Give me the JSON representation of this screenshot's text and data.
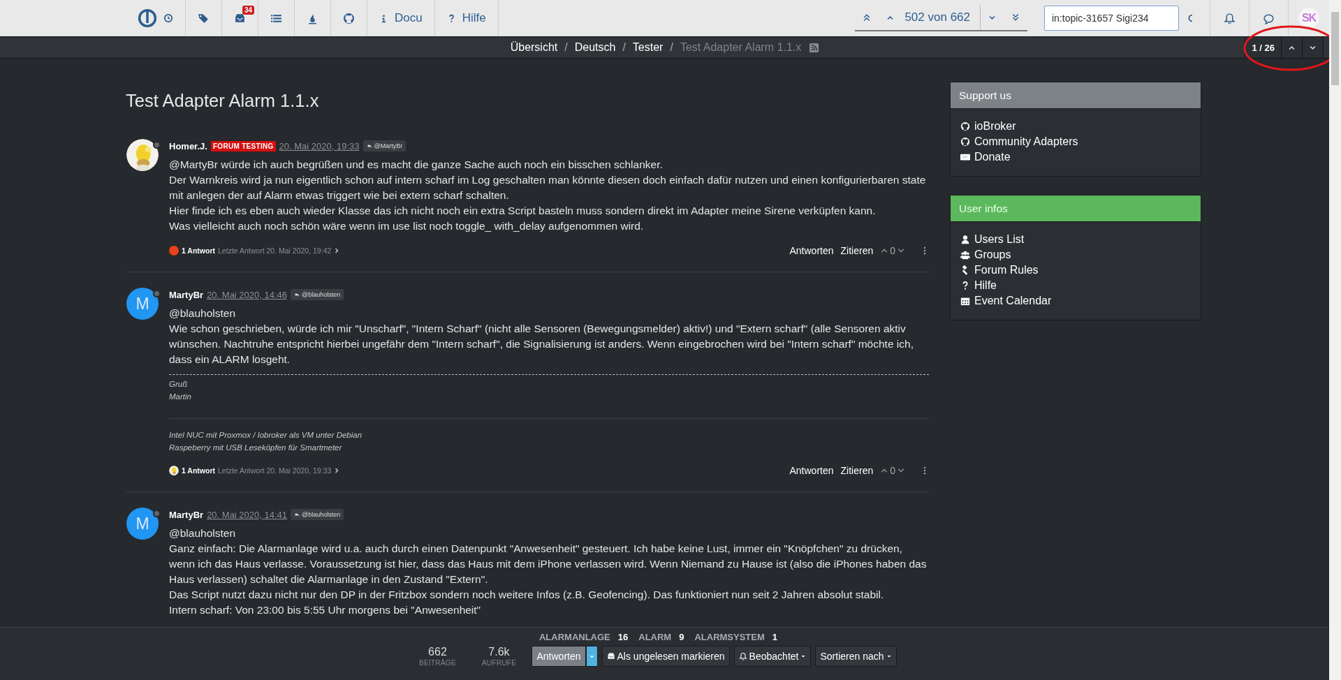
{
  "topbar": {
    "notifications": "34",
    "links": [
      {
        "kind": "info",
        "label": "Docu"
      },
      {
        "kind": "help",
        "label": "Hilfe"
      }
    ],
    "position": "502 von 662",
    "search": {
      "value": "in:topic-31657 Sigi234"
    },
    "user_initials": "SK"
  },
  "breadcrumbs": [
    {
      "label": "Übersicht",
      "current": false,
      "separator": "/"
    },
    {
      "label": "Deutsch",
      "current": false,
      "separator": "/"
    },
    {
      "label": "Tester",
      "current": false,
      "separator": "/"
    },
    {
      "label": "Test Adapter Alarm 1.1.x",
      "current": true
    }
  ],
  "pager": "1 / 26",
  "title": "Test Adapter Alarm 1.1.x",
  "posts": [
    {
      "author": {
        "name": "Homer.J.",
        "online": false
      },
      "badge": "FORUM TESTING",
      "date": "20. Mai 2020, 19:33",
      "reply_to": "@MartyBr",
      "paragraphs": [
        "@MartyBr würde ich auch begrüßen und es macht die ganze Sache auch noch ein bisschen schlanker.",
        "Der Warnkreis wird ja nun eigentlich schon auf intern scharf im Log geschalten man könnte diesen doch einfach dafür nutzen und einen konfigurierbaren state mit anlegen der auf Alarm etwas triggert wie bei extern scharf schalten.",
        "Hier finde ich es eben auch wieder Klasse das ich nicht noch ein extra Script basteln muss sondern direkt im Adapter meine Sirene verküpfen kann.",
        "Was vielleicht auch noch schön wäre wenn im use list noch toggle_ with_delay aufgenommen wird."
      ],
      "footer": {
        "avatar": {
          "kind": "color",
          "color": "#e8411c"
        },
        "replies": "1 Antwort",
        "last": "Letzte Antwort 20. Mai 2020, 19:42"
      },
      "actions": {
        "reply": "Antworten",
        "quote": "Zitieren",
        "votes": "0"
      }
    },
    {
      "author": {
        "name": "MartyBr",
        "online": false,
        "avatar": {
          "kind": "letter",
          "letter": "M",
          "color": "#2196f3"
        }
      },
      "date": "20. Mai 2020, 14:46",
      "reply_to": "@blauholsten",
      "paragraphs": [
        "@blauholsten",
        "Wie schon geschrieben, würde ich mir \"Unscharf\", \"Intern Scharf\" (nicht alle Sensoren (Bewegungsmelder) aktiv!) und \"Extern scharf\" (alle Sensoren aktiv",
        "wünschen. Nachtruhe entspricht hierbei ungefähr dem \"Intern scharf\", die Signalisierung ist anders. Wenn eingebrochen wird bei \"Intern scharf\" möchte ich, dass ein ALARM losgeht."
      ],
      "signature": {
        "greeting": [
          "Gruß",
          "Martin"
        ],
        "setup": [
          "Intel NUC mit Proxmox / Iobroker als VM unter Debian",
          "Raspeberry mit USB Leseköpfen für Smartmeter"
        ]
      },
      "footer": {
        "replies": "1 Antwort",
        "last": "Letzte Antwort 20. Mai 2020, 19:33"
      },
      "actions": {
        "reply": "Antworten",
        "quote": "Zitieren",
        "votes": "0"
      }
    },
    {
      "author": {
        "name": "MartyBr",
        "online": false,
        "avatar": {
          "kind": "letter",
          "letter": "M",
          "color": "#2196f3"
        }
      },
      "date": "20. Mai 2020, 14:41",
      "reply_to": "@blauholsten",
      "paragraphs": [
        "@blauholsten",
        "Ganz einfach: Die Alarmanlage wird u.a. auch durch einen Datenpunkt \"Anwesenheit\" gesteuert. Ich habe keine Lust, immer ein \"Knöpfchen\" zu drücken, wenn ich das Haus verlasse. Voraussetzung ist hier, dass das Haus mit dem iPhone verlassen wird. Wenn Niemand zu Hause ist (also die iPhones haben das Haus verlassen) schaltet die Alarmanlage in den Zustand \"Extern\".",
        "Das Script nutzt dazu nicht nur den DP in der Fritzbox sondern noch weitere Infos (z.B. Geofencing). Das funktioniert nun seit 2 Jahren absolut stabil.",
        "Intern scharf: Von 23:00 bis 5:55 Uhr morgens bei \"Anwesenheit\""
      ]
    }
  ],
  "sidebar": [
    {
      "title": "Support us",
      "kind": "neutral",
      "items": [
        {
          "kind": "github",
          "label": "ioBroker"
        },
        {
          "kind": "github",
          "label": "Community Adapters"
        },
        {
          "kind": "paypal",
          "label": "Donate"
        }
      ]
    },
    {
      "title": "User infos",
      "kind": "success",
      "items": [
        {
          "kind": "user",
          "label": "Users List"
        },
        {
          "kind": "users",
          "label": "Groups"
        },
        {
          "kind": "gavel",
          "label": "Forum Rules"
        },
        {
          "kind": "help",
          "label": "Hilfe"
        },
        {
          "kind": "calendar",
          "label": "Event Calendar"
        }
      ]
    }
  ],
  "bottom": {
    "tags": [
      {
        "name": "ALARMANLAGE",
        "count": "16"
      },
      {
        "name": "ALARM",
        "count": "9"
      },
      {
        "name": "ALARMSYSTEM",
        "count": "1"
      }
    ],
    "stats": [
      {
        "value": "662",
        "label": "BEITRÄGE"
      },
      {
        "value": "7.6k",
        "label": "AUFRUFE"
      }
    ],
    "buttons": [
      {
        "kind": "primary",
        "label": "Antworten"
      },
      {
        "kind": "unread",
        "label": "Als ungelesen markieren"
      },
      {
        "kind": "watch",
        "label": "Beobachtet"
      },
      {
        "kind": "sort",
        "label": "Sortieren nach"
      }
    ]
  }
}
